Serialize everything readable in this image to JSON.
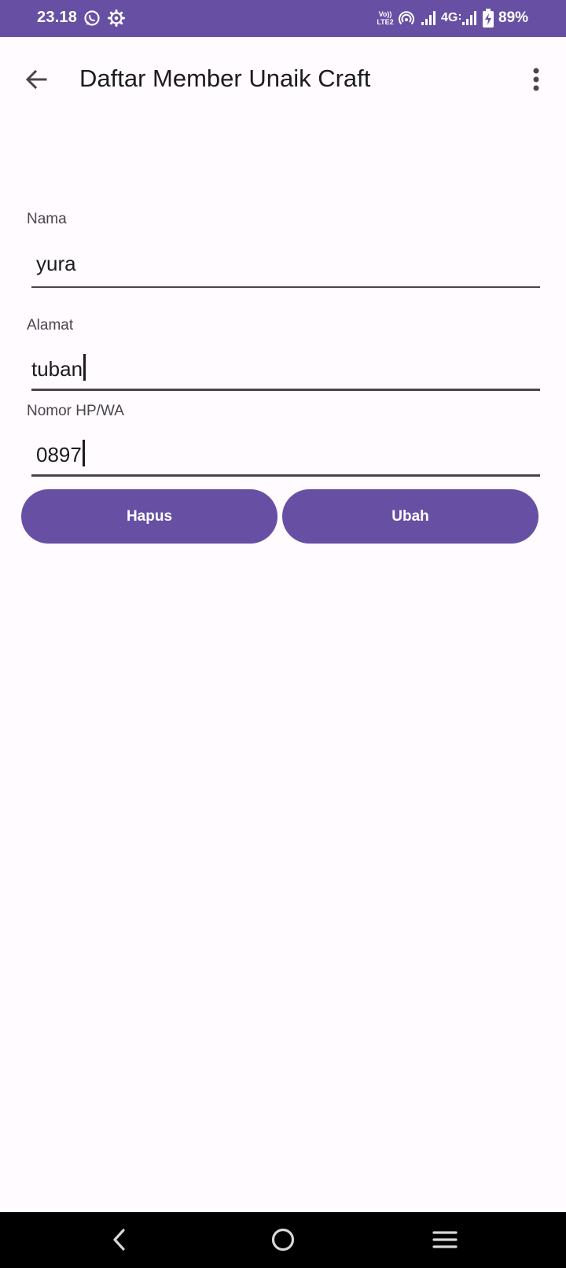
{
  "status_bar": {
    "time": "23.18",
    "network_label": "4G",
    "volte_label_top": "Vo))",
    "volte_label_bottom": "LTE2",
    "battery": "89%",
    "left_icons": [
      "whatsapp-icon",
      "settings-gear-icon"
    ],
    "right_icons": [
      "volte-icon",
      "hotspot-icon",
      "signal-icon",
      "signal-icon",
      "battery-charging-icon"
    ]
  },
  "app_bar": {
    "title": "Daftar Member Unaik Craft",
    "back_icon": "arrow-back-icon",
    "menu_icon": "more-vert-icon"
  },
  "form": {
    "nama": {
      "label": "Nama",
      "value": "yura"
    },
    "alamat": {
      "label": "Alamat",
      "value": "tuban"
    },
    "nomor": {
      "label": "Nomor HP/WA",
      "value": "0897"
    }
  },
  "buttons": {
    "hapus": "Hapus",
    "ubah": "Ubah"
  },
  "nav_bar": {
    "icons": [
      "nav-back-icon",
      "nav-home-icon",
      "nav-recents-icon"
    ]
  },
  "colors": {
    "primary": "#6750a4",
    "background": "#fffbfe",
    "text": "#1c1b1f",
    "label": "#49454f"
  }
}
